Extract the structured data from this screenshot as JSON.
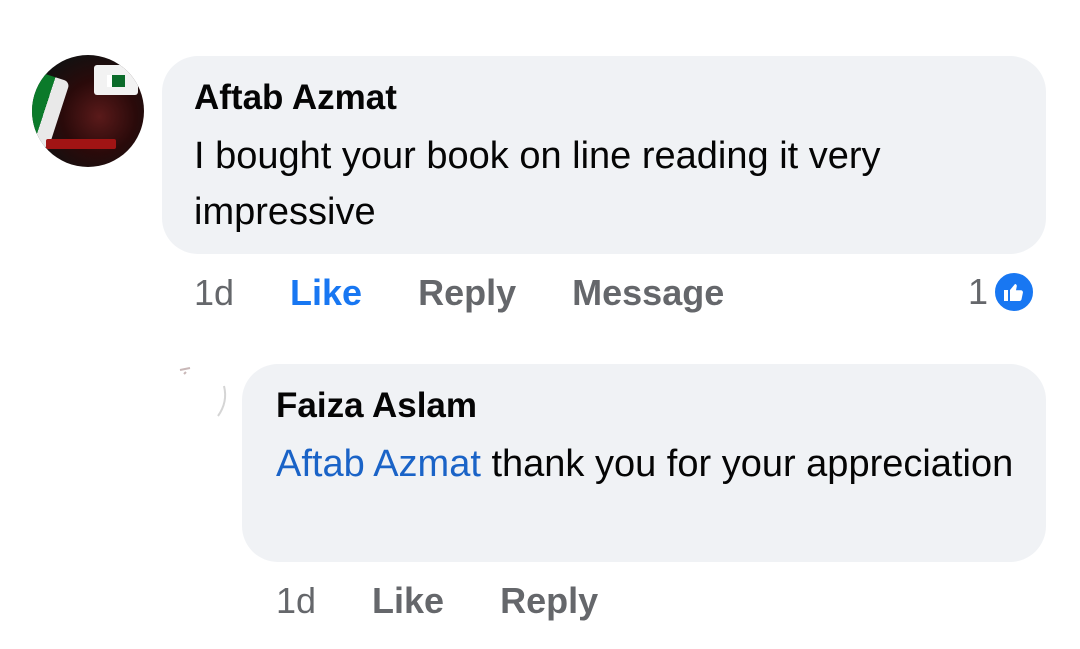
{
  "comment": {
    "author": "Aftab Azmat",
    "text": "I bought your book on line reading it very impressive",
    "time": "1d",
    "like_label": "Like",
    "reply_label": "Reply",
    "message_label": "Message",
    "reaction_count": "1",
    "like_state": "active"
  },
  "reply": {
    "author": "Faiza Aslam",
    "mention": "Aftab Azmat",
    "text": " thank you for your appreciation",
    "time": "1d",
    "like_label": "Like",
    "reply_label": "Reply"
  },
  "colors": {
    "bubble_bg": "#f0f2f5",
    "link_blue": "#1877f2",
    "muted_text": "#65676b",
    "primary_text": "#050505"
  }
}
